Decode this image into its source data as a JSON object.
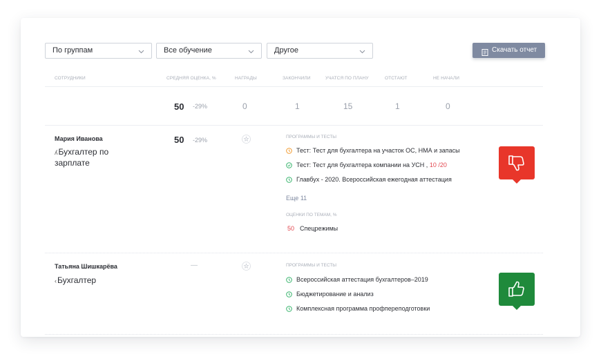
{
  "filters": {
    "group": "По группам",
    "training": "Все обучение",
    "other": "Другое"
  },
  "download_button": "Скачать отчет",
  "columns": {
    "employees": "Сотрудники",
    "avg_score": "Средняя оценка, %",
    "awards": "Награды",
    "finished": "Закончили",
    "on_plan": "Учатся по плану",
    "behind": "Отстают",
    "not_started": "Не начали"
  },
  "totals": {
    "avg": "50",
    "avg_delta": "-29%",
    "awards": "0",
    "finished": "1",
    "on_plan": "15",
    "behind": "1",
    "not_started": "0"
  },
  "employees": [
    {
      "name": "Мария Иванова",
      "role_prefix": "ʎ",
      "role": "Бухгалтер по зарплате",
      "avg": "50",
      "avg_delta": "-29%",
      "programs_label": "Программы и тесты",
      "programs": [
        {
          "status": "in-progress",
          "text": "Тест: Тест для бухгалтера на участок ОС, НМА и запасы",
          "score": ""
        },
        {
          "status": "passed",
          "text": "Тест: Тест для бухгалтера компании на УСН ,",
          "score": "10 /20"
        },
        {
          "status": "done",
          "text": "Главбух - 2020. Всероссийская ежегодная аттестация",
          "score": ""
        }
      ],
      "more": "Еще 11",
      "topics_label": "Оценки по темам, %",
      "topics": [
        {
          "score": "50",
          "name": "Спецрежимы"
        }
      ],
      "verdict": "thumbs-down",
      "verdict_color": "#e8362a"
    },
    {
      "name": "Татьяна Шишкарёва",
      "role_prefix": "‹",
      "role": "Бухгалтер",
      "avg": "—",
      "avg_delta": "",
      "programs_label": "Программы и тесты",
      "programs": [
        {
          "status": "done",
          "text": "Всероссийская аттестация бухгалтеров–2019",
          "score": ""
        },
        {
          "status": "done",
          "text": "Бюджетирование и анализ",
          "score": ""
        },
        {
          "status": "done",
          "text": "Комплексная программа профпереподготовки",
          "score": ""
        }
      ],
      "verdict": "thumbs-up",
      "verdict_color": "#1f8a3b"
    }
  ],
  "colors": {
    "accent_button": "#7f8aa1",
    "status_orange": "#f29a2e",
    "status_green": "#36b36b",
    "negative": "#e2474f"
  }
}
